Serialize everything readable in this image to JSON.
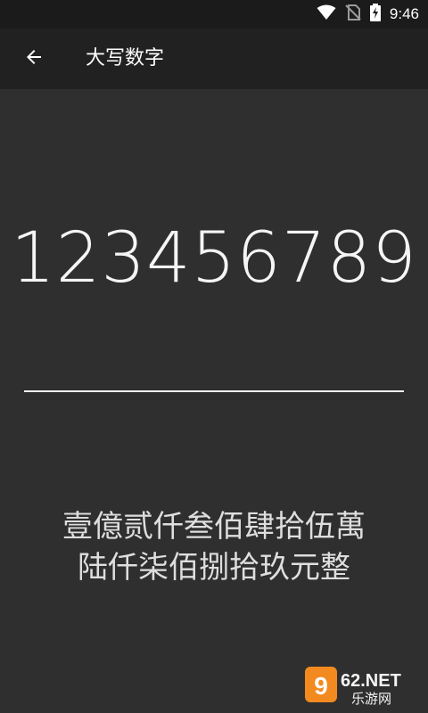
{
  "status_bar": {
    "time": "9:46"
  },
  "app_bar": {
    "title": "大写数字"
  },
  "input": {
    "value": "123456789"
  },
  "result": {
    "line1": "壹億贰仟叁佰肆拾伍萬",
    "line2": "陆仟柒佰捌拾玖元整"
  },
  "watermark": {
    "brand": "962.NET",
    "sub": "乐游网"
  }
}
